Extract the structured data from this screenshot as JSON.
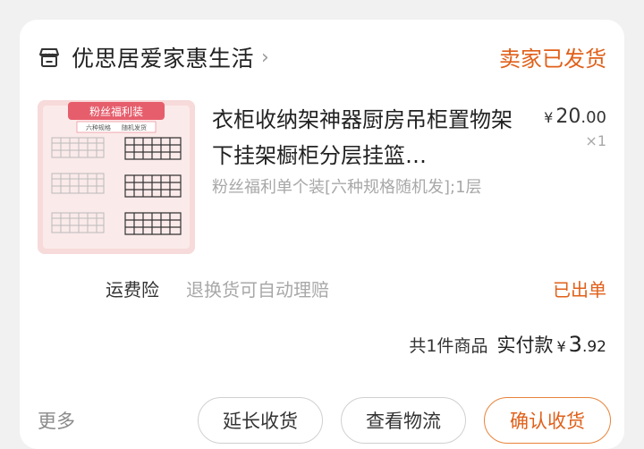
{
  "shop": {
    "name": "优思居爱家惠生活",
    "icon": "shop-icon",
    "status": "卖家已发货"
  },
  "product": {
    "title": "衣柜收纳架神器厨房吊柜置物架下挂架橱柜分层挂篮…",
    "spec": "粉丝福利单个装[六种规格随机发];1层",
    "price_currency": "¥",
    "price_int": "20",
    "price_dec": ".00",
    "qty": "×1",
    "thumb_banner": "粉丝福利装",
    "thumb_sub1": "六种规格",
    "thumb_sub2": "随机发货"
  },
  "insurance": {
    "label": "运费险",
    "desc": "退换货可自动理赔",
    "status": "已出单"
  },
  "summary": {
    "count": "共1件商品",
    "label": "实付款",
    "currency": "¥",
    "int": "3",
    "dec": ".92"
  },
  "actions": {
    "more": "更多",
    "extend": "延长收货",
    "logistics": "查看物流",
    "confirm": "确认收货"
  },
  "colors": {
    "accent": "#e0601a",
    "thumb_bg": "#f7dada"
  }
}
